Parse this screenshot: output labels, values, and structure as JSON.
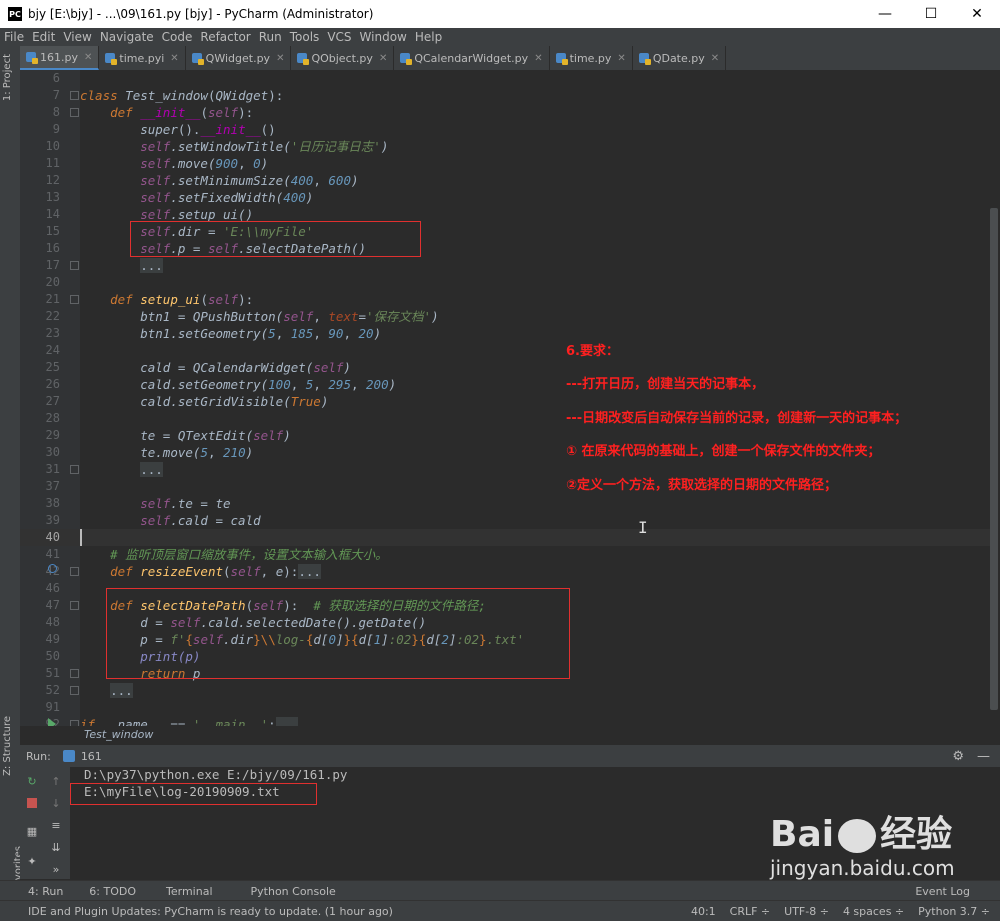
{
  "window": {
    "title": "bjy [E:\\bjy] - ...\\09\\161.py [bjy] - PyCharm (Administrator)",
    "logo": "PC",
    "controls": [
      "—",
      "☐",
      "✕"
    ]
  },
  "menu": [
    "File",
    "Edit",
    "View",
    "Navigate",
    "Code",
    "Refactor",
    "Run",
    "Tools",
    "VCS",
    "Window",
    "Help"
  ],
  "left_tool": {
    "project": "1: Project",
    "structure": "Z: Structure",
    "favorites": "2: Favorites"
  },
  "tabs": [
    {
      "label": "161.py",
      "active": true
    },
    {
      "label": "time.pyi",
      "active": false
    },
    {
      "label": "QWidget.py",
      "active": false
    },
    {
      "label": "QObject.py",
      "active": false
    },
    {
      "label": "QCalendarWidget.py",
      "active": false
    },
    {
      "label": "time.py",
      "active": false
    },
    {
      "label": "QDate.py",
      "active": false
    }
  ],
  "code_lines": [
    {
      "n": "6"
    },
    {
      "n": "7"
    },
    {
      "n": "8"
    },
    {
      "n": "9"
    },
    {
      "n": "10"
    },
    {
      "n": "11"
    },
    {
      "n": "12"
    },
    {
      "n": "13"
    },
    {
      "n": "14"
    },
    {
      "n": "15"
    },
    {
      "n": "16"
    },
    {
      "n": "17"
    },
    {
      "n": "20"
    },
    {
      "n": "21"
    },
    {
      "n": "22"
    },
    {
      "n": "23"
    },
    {
      "n": "24"
    },
    {
      "n": "25"
    },
    {
      "n": "26"
    },
    {
      "n": "27"
    },
    {
      "n": "28"
    },
    {
      "n": "29"
    },
    {
      "n": "30"
    },
    {
      "n": "31"
    },
    {
      "n": "37"
    },
    {
      "n": "38"
    },
    {
      "n": "39"
    },
    {
      "n": "40"
    },
    {
      "n": "41"
    },
    {
      "n": "42"
    },
    {
      "n": "46"
    },
    {
      "n": "47"
    },
    {
      "n": "48"
    },
    {
      "n": "49"
    },
    {
      "n": "50"
    },
    {
      "n": "51"
    },
    {
      "n": "52"
    },
    {
      "n": "91"
    },
    {
      "n": "92"
    }
  ],
  "code": {
    "l7": [
      "class",
      "Test_window",
      "QWidget"
    ],
    "l8": [
      "def",
      "__init__",
      "self"
    ],
    "l9": [
      "super",
      "__init__"
    ],
    "l10": [
      "self",
      ".setWindowTitle(",
      "'日历记事日志'",
      ")"
    ],
    "l11": [
      "self",
      ".move(",
      "900",
      ", ",
      "0",
      ")"
    ],
    "l12": [
      "self",
      ".setMinimumSize(",
      "400",
      ", ",
      "600",
      ")"
    ],
    "l13": [
      "self",
      ".setFixedWidth(",
      "400",
      ")"
    ],
    "l14": [
      "self",
      ".setup_ui()"
    ],
    "l15": [
      "self",
      ".dir = ",
      "'E:\\\\myFile'"
    ],
    "l16": [
      "self",
      ".p = ",
      "self",
      ".selectDatePath()"
    ],
    "l17": "...",
    "l21": [
      "def",
      "setup_ui",
      "self"
    ],
    "l22": [
      "btn1 = QPushButton(",
      "self",
      ", ",
      "text",
      "=",
      "'保存文档'",
      ")"
    ],
    "l23": [
      "btn1.setGeometry(",
      "5",
      ", ",
      "185",
      ", ",
      "90",
      ", ",
      "20",
      ")"
    ],
    "l25": [
      "cald = QCalendarWidget(",
      "self",
      ")"
    ],
    "l26": [
      "cald.setGeometry(",
      "100",
      ", ",
      "5",
      ", ",
      "295",
      ", ",
      "200",
      ")"
    ],
    "l27": [
      "cald.setGridVisible(",
      "True",
      ")"
    ],
    "l29": [
      "te = QTextEdit(",
      "self",
      ")"
    ],
    "l30": [
      "te.move(",
      "5",
      ", ",
      "210",
      ")"
    ],
    "l31": "...",
    "l38": [
      "self",
      ".te = te"
    ],
    "l39": [
      "self",
      ".cald = cald"
    ],
    "l41": "# 监听顶层窗口缩放事件，设置文本输入框大小。",
    "l42": [
      "def",
      "resizeEvent",
      "self",
      "e",
      "..."
    ],
    "l47": [
      "def",
      "selectDatePath",
      "self",
      "# 获取选择的日期的文件路径;"
    ],
    "l48": [
      "d = ",
      "self",
      ".cald.selectedDate().getDate()"
    ],
    "l49": [
      "p = ",
      "f'",
      "{",
      "self",
      ".dir",
      "}",
      "\\\\",
      "log-",
      "{",
      "d[",
      "0",
      "]",
      "}",
      "{",
      "d[",
      "1",
      "]",
      ":02",
      "}",
      "{",
      "d[",
      "2",
      "]",
      ":02",
      "}",
      ".txt'"
    ],
    "l50": [
      "print(p)"
    ],
    "l51": [
      "return",
      " p"
    ],
    "l52": "...",
    "l92": [
      "if",
      " __name__ == ",
      "'__main__'",
      ":",
      "..."
    ]
  },
  "notes": [
    "6.要求：",
    "---打开日历，创建当天的记事本，",
    "---日期改变后自动保存当前的记录，创建新一天的记事本；",
    "① 在原来代码的基础上，创建一个保存文件的文件夹；",
    "②定义一个方法，获取选择的日期的文件路径；"
  ],
  "breadcrumb": "Test_window",
  "run": {
    "label": "Run:",
    "config": "161",
    "output": [
      "D:\\py37\\python.exe E:/bjy/09/161.py",
      "E:\\myFile\\log-20190909.txt"
    ]
  },
  "bottom_tabs": [
    "4: Run",
    "6: TODO",
    "Terminal",
    "Python Console",
    "Event Log"
  ],
  "status": {
    "message": "IDE and Plugin Updates: PyCharm is ready to update. (1 hour ago)",
    "position": "40:1",
    "line_sep": "CRLF ÷",
    "encoding": "UTF-8 ÷",
    "indent": "4 spaces ÷",
    "python": "Python 3.7 ÷"
  },
  "watermark": {
    "brand": "Bai",
    "brand_suffix": "经验",
    "url": "jingyan.baidu.com"
  }
}
